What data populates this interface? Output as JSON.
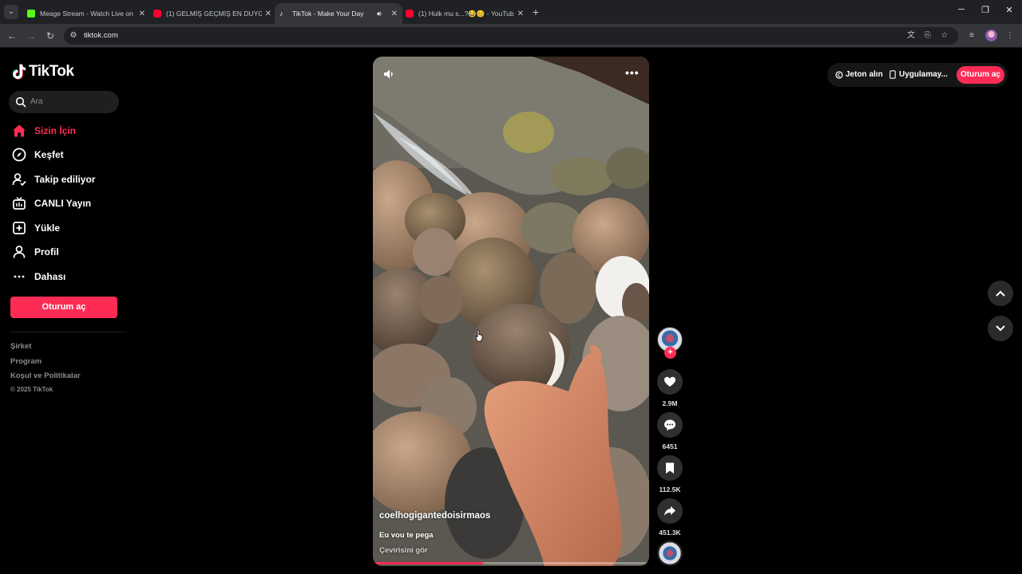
{
  "browser": {
    "tabs": [
      {
        "title": "Meage Stream - Watch Live on",
        "favicon": "kick-icon",
        "active": false
      },
      {
        "title": "(1) GELMİŞ GEÇMİŞ EN DUYGU",
        "favicon": "youtube-icon",
        "active": false
      },
      {
        "title": "TikTok - Make Your Day",
        "favicon": "tiktok-icon",
        "active": true
      },
      {
        "title": "(1) Hulk mu s...?😂😊 - YouTub",
        "favicon": "youtube-icon",
        "active": false
      }
    ],
    "url": "tiktok.com"
  },
  "sidebar": {
    "logo": "TikTok",
    "search_placeholder": "Ara",
    "items": [
      {
        "label": "Sizin İçin",
        "icon": "home-icon",
        "active": true
      },
      {
        "label": "Keşfet",
        "icon": "compass-icon",
        "active": false
      },
      {
        "label": "Takip ediliyor",
        "icon": "following-icon",
        "active": false
      },
      {
        "label": "CANLI Yayın",
        "icon": "live-icon",
        "active": false
      },
      {
        "label": "Yükle",
        "icon": "upload-icon",
        "active": false
      },
      {
        "label": "Profil",
        "icon": "profile-icon",
        "active": false
      },
      {
        "label": "Dahası",
        "icon": "more-icon",
        "active": false
      }
    ],
    "login_label": "Oturum aç",
    "footer": [
      "Şirket",
      "Program",
      "Koşul ve Politikalar"
    ],
    "copyright": "© 2025 TikTok"
  },
  "video": {
    "author": "coelhogigantedoisirmaos",
    "caption": "Eu vou te pega",
    "translate_label": "Çevirisini gör",
    "progress": 0.4
  },
  "actions": {
    "likes": "2.9M",
    "comments": "6451",
    "saves": "112.5K",
    "shares": "451.3K"
  },
  "header": {
    "coins_label": "Jeton alın",
    "app_label": "Uygulamay...",
    "login_label": "Oturum aç"
  },
  "colors": {
    "accent": "#fe2c55",
    "background": "#000000"
  }
}
